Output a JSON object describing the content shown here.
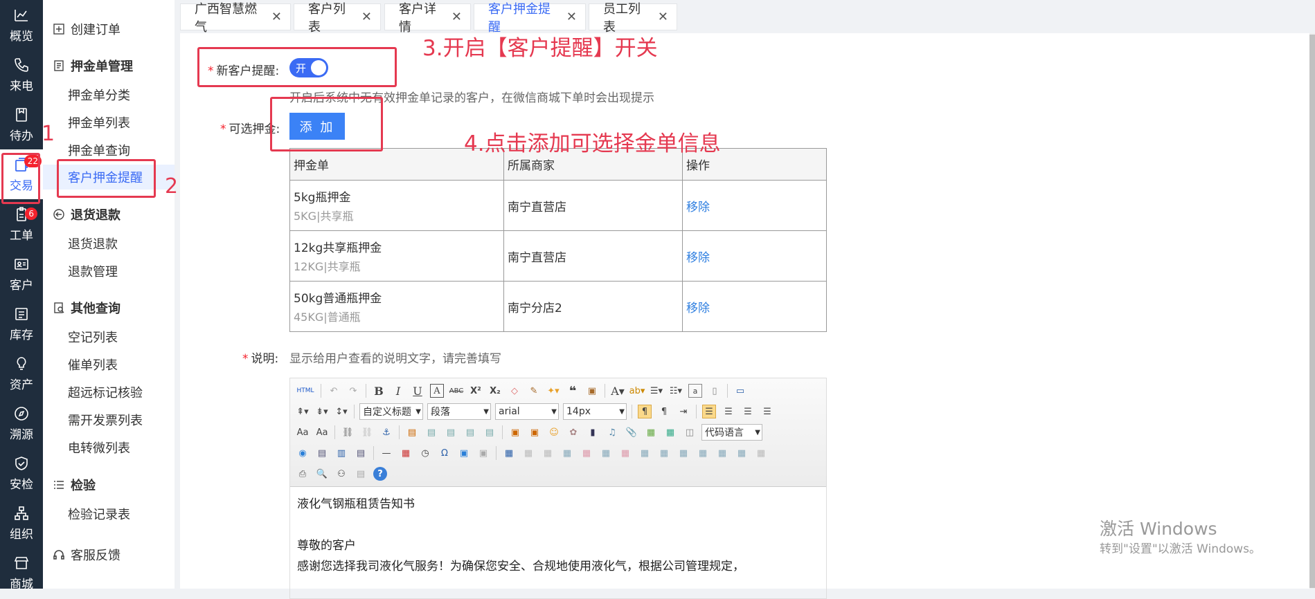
{
  "rail": {
    "items": [
      {
        "label": "概览",
        "icon": "chart-line-icon"
      },
      {
        "label": "来电",
        "icon": "phone-icon"
      },
      {
        "label": "待办",
        "icon": "clipboard-icon"
      },
      {
        "label": "交易",
        "icon": "transaction-icon",
        "badge": "22"
      },
      {
        "label": "工单",
        "icon": "work-order-icon",
        "badge": "6"
      },
      {
        "label": "客户",
        "icon": "customer-card-icon"
      },
      {
        "label": "库存",
        "icon": "inventory-icon"
      },
      {
        "label": "资产",
        "icon": "bulb-icon"
      },
      {
        "label": "溯源",
        "icon": "compass-icon"
      },
      {
        "label": "安检",
        "icon": "shield-check-icon"
      },
      {
        "label": "组织",
        "icon": "org-tree-icon"
      },
      {
        "label": "商城",
        "icon": "store-icon"
      }
    ]
  },
  "sidebar": {
    "create_order": "创建订单",
    "deposit_mgmt": "押金单管理",
    "deposit_category": "押金单分类",
    "deposit_list": "押金单列表",
    "deposit_query": "押金单查询",
    "customer_deposit_reminder": "客户押金提醒",
    "returns": "退货退款",
    "returns_refund": "退货退款",
    "refund_mgmt": "退款管理",
    "other_query": "其他查询",
    "empty_list": "空记列表",
    "urge_list": "催单列表",
    "overlimit_check": "超远标记核验",
    "invoice_list": "需开发票列表",
    "transfer_list": "电转微列表",
    "inspection": "检验",
    "inspection_records": "检验记录表",
    "feedback": "客服反馈"
  },
  "tabs": [
    {
      "label": "广西智慧燃气"
    },
    {
      "label": "客户列表"
    },
    {
      "label": "客户详情"
    },
    {
      "label": "客户押金提醒"
    },
    {
      "label": "员工列表"
    }
  ],
  "form": {
    "new_customer_reminder_label": "新客户提醒:",
    "toggle_text": "开",
    "toggle_on": true,
    "reminder_hint": "开启后系统中无有效押金单记录的客户，在微信商城下单时会出现提示",
    "selectable_deposit_label": "可选押金:",
    "add_button": "添 加",
    "description_label": "说明:",
    "description_hint": "显示给用户查看的说明文字，请完善填写"
  },
  "deposit_table": {
    "headers": [
      "押金单",
      "所属商家",
      "操作"
    ],
    "rows": [
      {
        "name": "5kg瓶押金",
        "spec": "5KG|共享瓶",
        "merchant": "南宁直营店",
        "action": "移除"
      },
      {
        "name": "12kg共享瓶押金",
        "spec": "12KG|共享瓶",
        "merchant": "南宁直营店",
        "action": "移除"
      },
      {
        "name": "50kg普通瓶押金",
        "spec": "45KG|普通瓶",
        "merchant": "南宁分店2",
        "action": "移除"
      }
    ]
  },
  "editor": {
    "toolbar": {
      "custom_title": "自定义标题",
      "paragraph": "段落",
      "font": "arial",
      "size": "14px",
      "code_lang": "代码语言",
      "html_label": "HTML"
    },
    "content": [
      "液化气钢瓶租赁告知书",
      "",
      "尊敬的客户",
      "感谢您选择我司液化气服务！为确保您安全、合规地使用液化气，根据公司管理规定，"
    ]
  },
  "annotations": {
    "step1": "1",
    "step2": "2",
    "step3": "3.开启【客户提醒】开关",
    "step4": "4.点击添加可选择金单信息"
  },
  "watermark": {
    "line1": "激活 Windows",
    "line2": "转到\"设置\"以激活 Windows。"
  },
  "colors": {
    "accent": "#3b6bf4",
    "annotation": "#e53950",
    "rail_bg": "#1f2d3d",
    "badge": "#f5222d"
  }
}
